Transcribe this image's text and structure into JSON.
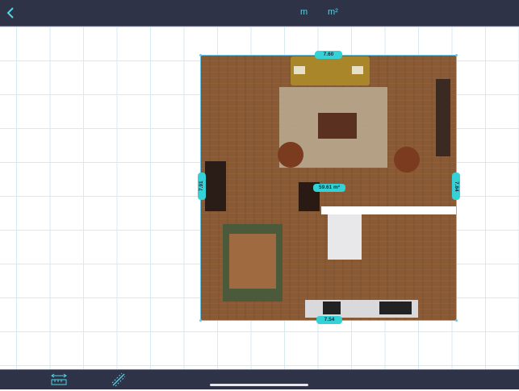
{
  "topbar": {
    "unit_m": "m",
    "unit_m2": "m²"
  },
  "measurements": {
    "top_width": "7.60",
    "bottom_width": "7.54",
    "left_height": "7.91",
    "right_height": "7.84",
    "area": "59.61 m²"
  },
  "icons": {
    "back": "chevron-left-icon",
    "measure_tool": "ruler-icon",
    "draw_tool": "pencil-icon"
  },
  "colors": {
    "bar_bg": "#2e3348",
    "accent": "#34d2d6",
    "unit_text": "#4fd6e6"
  }
}
